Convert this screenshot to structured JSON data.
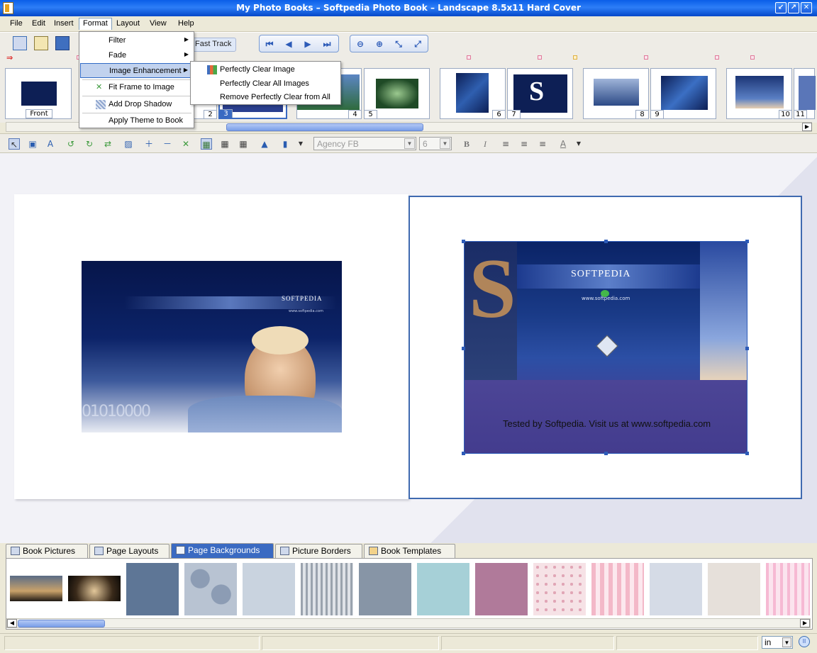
{
  "window": {
    "title": "My Photo Books – Softpedia Photo Book – Landscape 8.5x11 Hard Cover"
  },
  "menubar": [
    "File",
    "Edit",
    "Insert",
    "Format",
    "Layout",
    "View",
    "Help"
  ],
  "toolbar": {
    "fast_track": "Fast Track"
  },
  "thumbnails": {
    "front_label": "Front",
    "pages": [
      "2",
      "3",
      "4",
      "5",
      "6",
      "7",
      "8",
      "9",
      "10",
      "11"
    ]
  },
  "format_menu": {
    "items": [
      "Filter",
      "Fade",
      "Image Enhancement",
      "Fit Frame to Image",
      "Add Drop Shadow",
      "Apply Theme to Book"
    ]
  },
  "enhancement_submenu": {
    "items": [
      "Perfectly Clear Image",
      "Perfectly Clear All Images",
      "Remove Perfectly Clear from All"
    ]
  },
  "font": {
    "family": "Agency FB",
    "size": "6"
  },
  "page_right": {
    "caption": "Tested by Softpedia. Visit us at www.softpedia.com",
    "logo_text": "SOFTPEDIA",
    "url_text": "www.softpedia.com",
    "big_letter": "S"
  },
  "page_left": {
    "logo_text": "SOFTPEDIA",
    "url_text": "www.softpedia.com"
  },
  "tabs": [
    "Book Pictures",
    "Page Layouts",
    "Page Backgrounds",
    "Picture Borders",
    "Book Templates"
  ],
  "statusbar": {
    "unit": "in"
  },
  "colors": {
    "titlebar": "#0a5ee8",
    "selection": "#3a6ac2",
    "dark_blue_image": "#0d1f55"
  }
}
